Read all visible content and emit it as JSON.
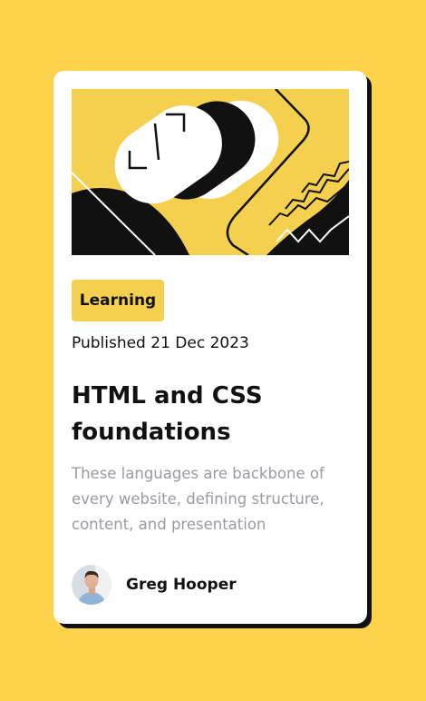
{
  "card": {
    "tag": "Learning",
    "published": "Published 21 Dec 2023",
    "title": "HTML and CSS foundations",
    "description": "These languages are backbone of every website, defining structure, content, and presentation",
    "author": {
      "name": "Greg Hooper"
    }
  },
  "colors": {
    "background": "#FDD34C",
    "accent": "#F4D04E",
    "text": "#111111",
    "muted_text": "#9A9AA3",
    "card": "#FFFFFF",
    "shadow": "#111111"
  }
}
